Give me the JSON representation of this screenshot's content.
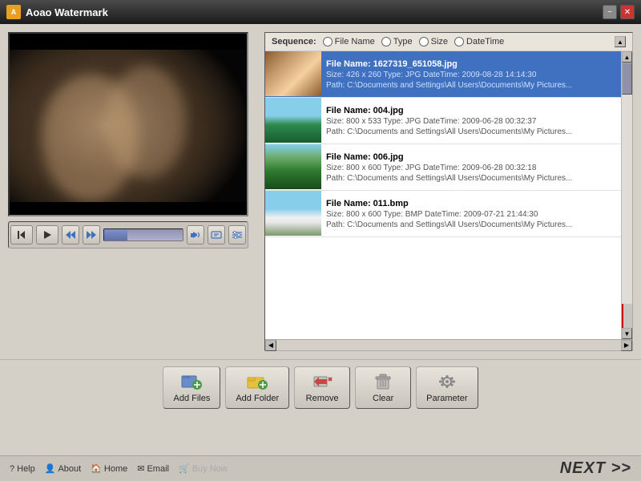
{
  "titleBar": {
    "appName": "Aoao Watermark",
    "iconText": "A",
    "minimizeLabel": "−",
    "closeLabel": "✕"
  },
  "sequence": {
    "label": "Sequence:",
    "options": [
      {
        "id": "filename",
        "label": "File Name",
        "active": false
      },
      {
        "id": "type",
        "label": "Type",
        "active": false
      },
      {
        "id": "size",
        "label": "Size",
        "active": false
      },
      {
        "id": "datetime",
        "label": "DateTime",
        "active": false
      }
    ]
  },
  "fileList": {
    "items": [
      {
        "name": "File Name: 1627319_651058.jpg",
        "size": "Size: 426 x 260",
        "type": "Type: JPG",
        "datetime": "DateTime: 2009-08-28 14:14:30",
        "path": "Path: C:\\Documents and Settings\\All Users\\Documents\\My Pictures...",
        "selected": true,
        "thumbClass": "thumb-1"
      },
      {
        "name": "File Name: 004.jpg",
        "size": "Size: 800 x 533",
        "type": "Type: JPG",
        "datetime": "DateTime: 2009-06-28 00:32:37",
        "path": "Path: C:\\Documents and Settings\\All Users\\Documents\\My Pictures...",
        "selected": false,
        "thumbClass": "thumb-2"
      },
      {
        "name": "File Name: 006.jpg",
        "size": "Size: 800 x 600",
        "type": "Type: JPG",
        "datetime": "DateTime: 2009-06-28 00:32:18",
        "path": "Path: C:\\Documents and Settings\\All Users\\Documents\\My Pictures...",
        "selected": false,
        "thumbClass": "thumb-3"
      },
      {
        "name": "File Name: 011.bmp",
        "size": "Size: 800 x 600",
        "type": "Type: BMP",
        "datetime": "DateTime: 2009-07-21 21:44:30",
        "path": "Path: C:\\Documents and Settings\\All Users\\Documents\\My Pictures...",
        "selected": false,
        "thumbClass": "thumb-4"
      }
    ]
  },
  "toolbar": {
    "addFilesLabel": "Add Files",
    "addFolderLabel": "Add Folder",
    "removeLabel": "Remove",
    "clearLabel": "Clear",
    "parameterLabel": "Parameter"
  },
  "controls": {
    "prevLabel": "⏮",
    "playLabel": "▶"
  },
  "bottomLinks": [
    {
      "icon": "?",
      "label": "Help"
    },
    {
      "icon": "👤",
      "label": "About"
    },
    {
      "icon": "🏠",
      "label": "Home"
    },
    {
      "icon": "✉",
      "label": "Email"
    },
    {
      "icon": "🛒",
      "label": "Buy Now"
    }
  ],
  "nextButton": "NEXT >>"
}
